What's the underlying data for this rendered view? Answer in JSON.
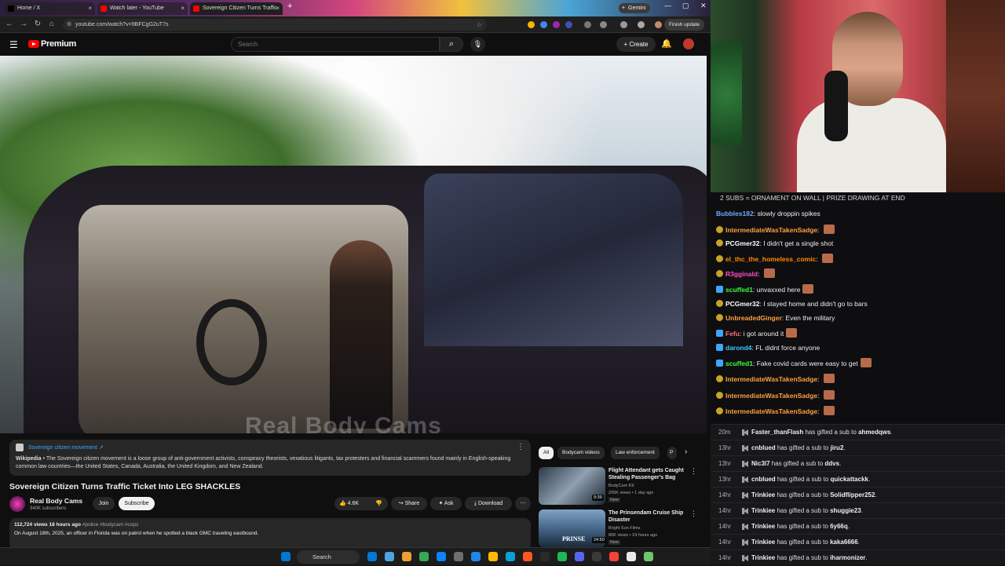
{
  "browser": {
    "tabs": [
      {
        "label": "Home / X",
        "icon_color": "#000000",
        "close": "×"
      },
      {
        "label": "Watch later - YouTube",
        "icon_color": "#ff0000",
        "close": "×"
      },
      {
        "label": "Sovereign Citizen Turns Traffic",
        "icon_color": "#ff0000",
        "close": "×"
      }
    ],
    "new_tab": "+",
    "gemini_label": "Gemini",
    "url": "youtube.com/watch?v=9BFCgG2uT7s",
    "finish_update": "Finish update",
    "window_controls": [
      "—",
      "▢",
      "✕"
    ]
  },
  "youtube": {
    "logo_text": "Premium",
    "search_placeholder": "Search",
    "create_label": "+ Create",
    "video_watermark": "Real Body Cams",
    "wiki": {
      "title": "Sovereign citizen movement ↗",
      "source": "Wikipedia",
      "text": " • The Sovereign citizen movement is a loose group of anti-government activists, conspiracy theorists, vexatious litigants, tax protesters and financial scammers found mainly in English-speaking common law countries—the United States, Canada, Australia, the United Kingdom, and New Zealand."
    },
    "video_title": "Sovereign Citizen Turns Traffic Ticket Into LEG SHACKLES",
    "channel": {
      "name": "Real Body Cams",
      "subscribers": "340K subscribers"
    },
    "actions": {
      "join": "Join",
      "subscribe": "Subscribe",
      "likes": "4.6K",
      "share": "Share",
      "ask": "Ask",
      "download": "Download"
    },
    "description": {
      "stats": "112,724 views  18 hours ago",
      "tags": "#police #bodycam #cops",
      "text": "On August 18th, 2025, an officer in Florida was on patrol when he spotted a black GMC traveling eastbound."
    },
    "chips": [
      "All",
      "Bodycam videos",
      "Law enforcement",
      "P"
    ],
    "recommendations": [
      {
        "title": "Flight Attendant gets Caught Stealing Passenger's Bag",
        "channel": "BodyCam K9",
        "meta": "205K views • 1 day ago",
        "badge": "New",
        "duration": "9:39",
        "thumb_color": "#3a4a5a"
      },
      {
        "title": "The Prinsendam Cruise Ship Disaster",
        "channel": "Bright Sun Films",
        "meta": "80K views • 19 hours ago",
        "badge": "New",
        "duration": "24:50",
        "thumb_color": "#4a6d8a",
        "thumb_text": "PRINSE"
      }
    ]
  },
  "stream": {
    "banner": "2 SUBS = ORNAMENT ON WALL | PRIZE DRAWING AT END",
    "chat": [
      {
        "user": "Bubbles182",
        "text": "slowly droppin spikes",
        "color": "#6fa8ff",
        "badge": "none",
        "emote": false
      },
      {
        "user": "IntermediateWasTakenSadge",
        "text": "",
        "color": "#ff9f40",
        "badge": "gold",
        "emote": true
      },
      {
        "user": "PCGmer32",
        "text": "I didn't get a single shot",
        "color": "#ffffff",
        "badge": "gold",
        "emote": false
      },
      {
        "user": "el_thc_the_homeless_comic",
        "text": "",
        "color": "#ff8c00",
        "badge": "gold",
        "emote": true
      },
      {
        "user": "R3gginald",
        "text": "",
        "color": "#ff4fc8",
        "badge": "gold",
        "emote": true
      },
      {
        "user": "scuffed1",
        "text": "unvaxxed here",
        "color": "#3cff3c",
        "badge": "blue",
        "emote": true
      },
      {
        "user": "PCGmer32",
        "text": "I stayed home and didn't go to bars",
        "color": "#ffffff",
        "badge": "gold",
        "emote": false
      },
      {
        "user": "UnbreadedGinger",
        "text": "Even the military",
        "color": "#ffa040",
        "badge": "gold",
        "emote": false
      },
      {
        "user": "Fefu",
        "text": "i got around it",
        "color": "#ff6a6a",
        "badge": "blue",
        "emote": true
      },
      {
        "user": "darond4",
        "text": "FL didnt force anyone",
        "color": "#40c8ff",
        "badge": "blue",
        "emote": false
      },
      {
        "user": "scuffed1",
        "text": "Fake covid cards were easy to get",
        "color": "#3cff3c",
        "badge": "blue",
        "emote": true
      },
      {
        "user": "IntermediateWasTakenSadge",
        "text": "",
        "color": "#ff9f40",
        "badge": "gold",
        "emote": true
      },
      {
        "user": "IntermediateWasTakenSadge",
        "text": "",
        "color": "#ff9f40",
        "badge": "gold",
        "emote": true
      },
      {
        "user": "IntermediateWasTakenSadge",
        "text": "",
        "color": "#ff9f40",
        "badge": "gold",
        "emote": true
      }
    ],
    "events": [
      {
        "time": "20m",
        "gifter": "Faster_thanFlash",
        "recipient": "ahmedqws"
      },
      {
        "time": "13hr",
        "gifter": "cnblued",
        "recipient": "jiru2"
      },
      {
        "time": "13hr",
        "gifter": "Nic3l7",
        "recipient": "ddvs"
      },
      {
        "time": "13hr",
        "gifter": "cnblued",
        "recipient": "quickattackk"
      },
      {
        "time": "14hr",
        "gifter": "Trinkiee",
        "recipient": "Solidflipper252"
      },
      {
        "time": "14hr",
        "gifter": "Trinkiee",
        "recipient": "shuggie23"
      },
      {
        "time": "14hr",
        "gifter": "Trinkiee",
        "recipient": "6y66q"
      },
      {
        "time": "14hr",
        "gifter": "Trinkiee",
        "recipient": "kaka6666"
      },
      {
        "time": "14hr",
        "gifter": "Trinkiee",
        "recipient": "iharmonizer"
      }
    ],
    "event_phrase": " has gifted a sub to ",
    "event_suffix": "."
  },
  "taskbar": {
    "search_label": "Search",
    "apps": [
      "#0078d4",
      "#4fa3e0",
      "#f0a030",
      "#34a853",
      "#0a84ff",
      "#6e6e6e",
      "#1e88e5",
      "#ffb900",
      "#0aa0d6",
      "#ff5722",
      "#2a2a2a",
      "#1db954",
      "#5865f2",
      "#3a3a3a",
      "#f44336",
      "#e9e9e9",
      "#6ec56e"
    ]
  }
}
